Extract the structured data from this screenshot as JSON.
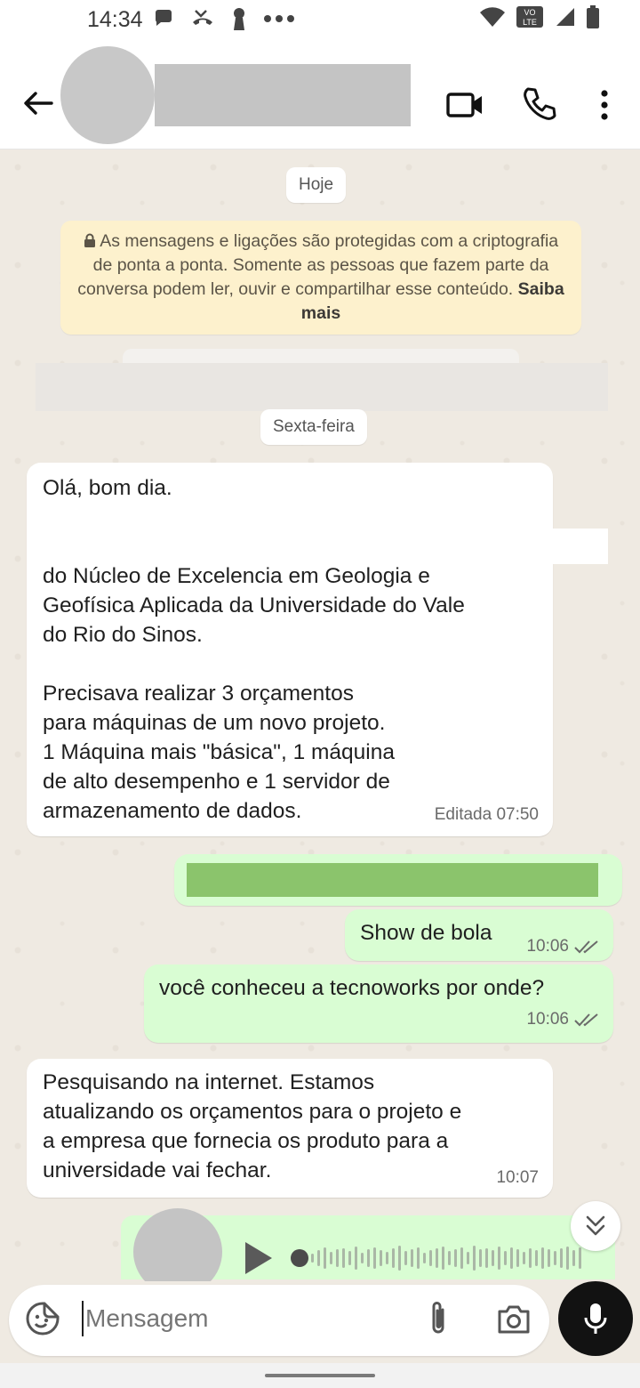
{
  "status_bar": {
    "time": "14:34",
    "icons": [
      "chat-bubble-icon",
      "missed-call-icon",
      "keyhole-icon",
      "more-dots-icon",
      "wifi-icon",
      "volte-icon",
      "signal-icon",
      "battery-icon"
    ],
    "volte_top": "VO",
    "volte_bottom": "LTE"
  },
  "header": {
    "icons": [
      "back-arrow-icon",
      "video-call-icon",
      "phone-icon",
      "more-vertical-icon"
    ]
  },
  "chat": {
    "date_today": "Hoje",
    "encryption_notice": {
      "text": "As mensagens e ligações são protegidas com a criptografia de ponta a ponta. Somente as pessoas que fazem parte da conversa podem ler, ouvir e compartilhar esse conteúdo.",
      "link": "Saiba mais"
    },
    "date_friday": "Sexta-feira",
    "messages": [
      {
        "direction": "incoming",
        "lines": [
          "Olá, bom dia.",
          "",
          "",
          "do Núcleo de Excelencia em Geologia e",
          "Geofísica Aplicada da Universidade do Vale",
          "do Rio do Sinos.",
          "",
          "Precisava realizar 3 orçamentos",
          "para máquinas de um novo projeto.",
          "1 Máquina mais \"básica\", 1 máquina",
          "de alto desempenho e 1 servidor de",
          "armazenamento de dados."
        ],
        "meta": "Editada 07:50"
      },
      {
        "direction": "outgoing",
        "text": "Show de bola",
        "meta": "10:06",
        "status": "read"
      },
      {
        "direction": "outgoing",
        "text": "você conheceu a tecnoworks por onde?",
        "meta": "10:06",
        "status": "read"
      },
      {
        "direction": "incoming",
        "lines": [
          "Pesquisando na internet. Estamos",
          "atualizando os orçamentos para o projeto e",
          "a empresa que fornecia os produto para a",
          "universidade vai fechar."
        ],
        "meta": "10:07"
      }
    ]
  },
  "input_bar": {
    "placeholder": "Mensagem",
    "icons": [
      "sticker-icon",
      "attach-icon",
      "camera-icon",
      "mic-icon"
    ]
  },
  "colors": {
    "chat_background": "#efeae2",
    "incoming_bubble": "#ffffff",
    "outgoing_bubble": "#d9fdd3",
    "notice_background": "#fdf1cd",
    "mic_button": "#121212"
  }
}
